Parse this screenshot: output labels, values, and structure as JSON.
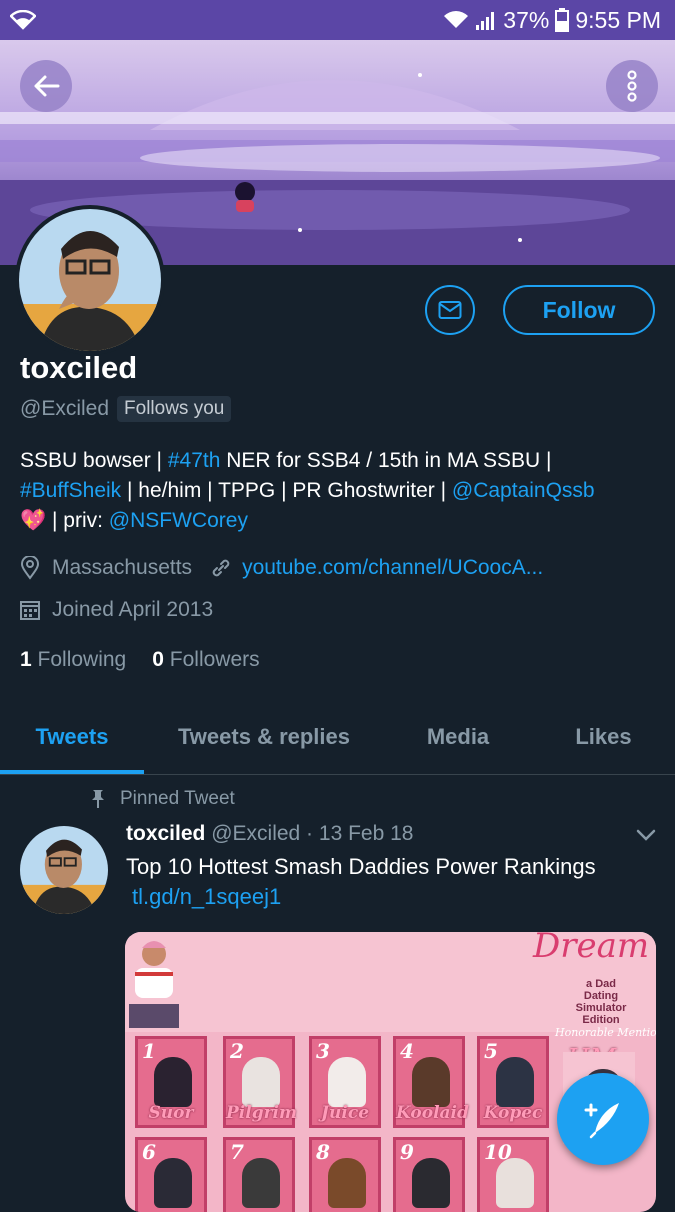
{
  "status_bar": {
    "battery": "37%",
    "time": "9:55 PM"
  },
  "profile": {
    "display_name": "toxciled",
    "handle": "@Exciled",
    "follows_you": "Follows you",
    "follow_label": "Follow",
    "bio": {
      "line1": {
        "a": "SSBU bowser | ",
        "hashtag": "#47th",
        "b": " NER for SSB4 / 15th in MA SSBU |"
      },
      "line2": {
        "hashtag": "#BuffSheik",
        "a": " | he/him | TPPG | PR Ghostwriter | ",
        "mention": "@CaptainQssb"
      },
      "line3": {
        "emoji": "💖",
        "a": " | priv: ",
        "mention": "@NSFWCorey"
      }
    },
    "location": "Massachusetts",
    "website": "youtube.com/channel/UCoocA...",
    "joined": "Joined April 2013",
    "following_count": "1",
    "following_label": "Following",
    "followers_count": "0",
    "followers_label": "Followers"
  },
  "tabs": [
    {
      "label": "Tweets",
      "active": true
    },
    {
      "label": "Tweets & replies",
      "active": false
    },
    {
      "label": "Media",
      "active": false
    },
    {
      "label": "Likes",
      "active": false
    }
  ],
  "pinned_tweet": {
    "pinned_label": "Pinned Tweet",
    "name": "toxciled",
    "handle": "@Exciled",
    "sep": " · ",
    "date": "13 Feb 18",
    "text": "Top 10 Hottest Smash Daddies Power Rankings",
    "link": "tl.gd/n_1sqeej1",
    "media": {
      "title": "Dream Daddy",
      "subtitle": "a Dad Dating Simulator Edition",
      "honorable": "Honorable Mentions",
      "hm": "HM",
      "cards": [
        {
          "rank": "1",
          "name": "Suor"
        },
        {
          "rank": "2",
          "name": "Pilgrim"
        },
        {
          "rank": "3",
          "name": "Juice"
        },
        {
          "rank": "4",
          "name": "Koolaid"
        },
        {
          "rank": "5",
          "name": "Kopec"
        },
        {
          "rank": "6",
          "name": ""
        },
        {
          "rank": "7",
          "name": ""
        },
        {
          "rank": "8",
          "name": ""
        },
        {
          "rank": "9",
          "name": ""
        },
        {
          "rank": "10",
          "name": ""
        }
      ]
    }
  },
  "colors": {
    "accent": "#1da1f2",
    "background": "#15202b",
    "status_bar": "#5b46a6"
  },
  "icons": [
    "wifi-icon",
    "signal-icon",
    "battery-icon",
    "back-arrow-icon",
    "more-vert-icon",
    "mail-icon",
    "location-icon",
    "link-icon",
    "calendar-icon",
    "pin-icon",
    "chevron-down-icon",
    "compose-tweet-icon"
  ]
}
